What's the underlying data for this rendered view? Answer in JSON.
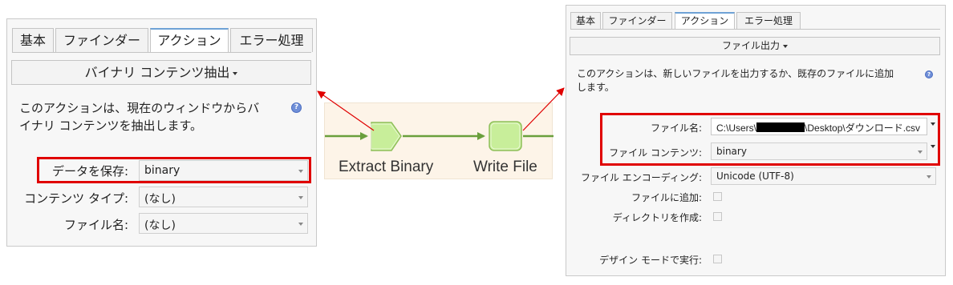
{
  "left_panel": {
    "tabs": [
      {
        "label": "基本",
        "active": false
      },
      {
        "label": "ファインダー",
        "active": false
      },
      {
        "label": "アクション",
        "active": true
      },
      {
        "label": "エラー処理",
        "active": false
      }
    ],
    "action_label": "バイナリ コンテンツ抽出",
    "description": "このアクションは、現在のウィンドウからバ\nイナリ コンテンツを抽出します。",
    "fields": [
      {
        "label": "データを保存:",
        "value": "binary"
      },
      {
        "label": "コンテンツ タイプ:",
        "value": "(なし)"
      },
      {
        "label": "ファイル名:",
        "value": "(なし)"
      }
    ]
  },
  "flow": {
    "nodes": [
      {
        "label": "Extract Binary"
      },
      {
        "label": "Write File"
      }
    ]
  },
  "right_panel": {
    "tabs": [
      {
        "label": "基本",
        "active": false
      },
      {
        "label": "ファインダー",
        "active": false
      },
      {
        "label": "アクション",
        "active": true
      },
      {
        "label": "エラー処理",
        "active": false
      }
    ],
    "action_label": "ファイル出力",
    "description": "このアクションは、新しいファイルを出力するか、既存のファイルに追加\nします。",
    "fields": {
      "file_name": {
        "label": "ファイル名:",
        "value_prefix": "C:\\Users\\",
        "value_suffix": "\\Desktop\\ダウンロード.csv"
      },
      "file_contents": {
        "label": "ファイル コンテンツ:",
        "value": "binary"
      },
      "encoding": {
        "label": "ファイル エンコーディング:",
        "value": "Unicode (UTF-8)"
      },
      "append": {
        "label": "ファイルに追加:",
        "checked": false
      },
      "create_dir": {
        "label": "ディレクトリを作成:",
        "checked": false
      },
      "design_mode": {
        "label": "デザイン モードで実行:",
        "checked": false
      }
    }
  },
  "colors": {
    "highlight": "#e00000",
    "arrow": "#e00000",
    "node_fill": "#c8ee9a",
    "connector": "#6a9f3c",
    "flow_bg": "#fdf4e8",
    "active_tab_accent": "#6ea2d6"
  }
}
